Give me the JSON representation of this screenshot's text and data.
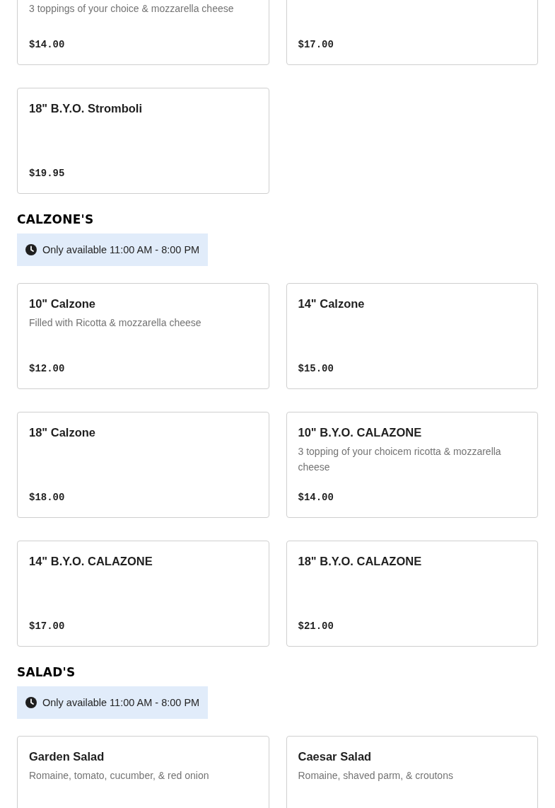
{
  "sections": [
    {
      "items": [
        {
          "description": "3 toppings of your choice & mozzarella cheese",
          "price": "$14.00"
        },
        {
          "price": "$17.00"
        },
        {
          "name": "18\" B.Y.O. Stromboli",
          "price": "$19.95"
        }
      ]
    },
    {
      "title": "CALZONE'S",
      "availability": "Only available 11:00 AM - 8:00 PM",
      "items": [
        {
          "name": "10\" Calzone",
          "description": "Filled with Ricotta & mozzarella cheese",
          "price": "$12.00"
        },
        {
          "name": "14\" Calzone",
          "price": "$15.00"
        },
        {
          "name": "18\" Calzone",
          "price": "$18.00"
        },
        {
          "name": "10\" B.Y.O. CALAZONE",
          "description": "3 topping of your choicem ricotta & mozzarella cheese",
          "price": "$14.00"
        },
        {
          "name": "14\" B.Y.O. CALAZONE",
          "price": "$17.00"
        },
        {
          "name": "18\" B.Y.O. CALAZONE",
          "price": "$21.00"
        }
      ]
    },
    {
      "title": "SALAD'S",
      "availability": "Only available 11:00 AM - 8:00 PM",
      "items": [
        {
          "name": "Garden Salad",
          "description": "Romaine, tomato, cucumber, & red onion"
        },
        {
          "name": "Caesar Salad",
          "description": "Romaine, shaved parm, & croutons"
        }
      ]
    }
  ]
}
